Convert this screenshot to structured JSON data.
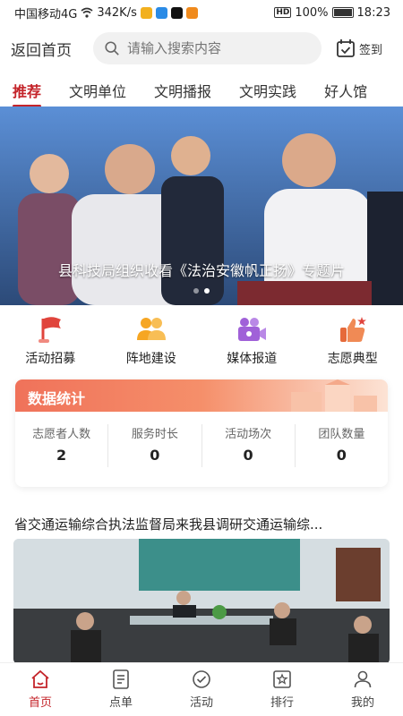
{
  "status_bar": {
    "carrier": "中国移动4G",
    "net_speed": "342K/s",
    "hd": "HD",
    "battery": "100%",
    "time": "18:23"
  },
  "header": {
    "back_label": "返回首页",
    "search_placeholder": "请输入搜索内容",
    "checkin_label": "签到"
  },
  "tabs": [
    {
      "label": "推荐",
      "active": true
    },
    {
      "label": "文明单位"
    },
    {
      "label": "文明播报"
    },
    {
      "label": "文明实践"
    },
    {
      "label": "好人馆"
    }
  ],
  "banner": {
    "caption": "县科技局组织收看《法治安徽帆正扬》专题片",
    "slide_count": 2,
    "active_slide": 2
  },
  "quick_menu": [
    {
      "label": "活动招募",
      "icon": "flag-icon"
    },
    {
      "label": "阵地建设",
      "icon": "people-icon"
    },
    {
      "label": "媒体报道",
      "icon": "video-camera-icon"
    },
    {
      "label": "志愿典型",
      "icon": "thumbs-up-icon"
    }
  ],
  "stats": {
    "title": "数据统计",
    "items": [
      {
        "label": "志愿者人数",
        "value": "2"
      },
      {
        "label": "服务时长",
        "value": "0"
      },
      {
        "label": "活动场次",
        "value": "0"
      },
      {
        "label": "团队数量",
        "value": "0"
      }
    ]
  },
  "news": {
    "title": "省交通运输综合执法监督局来我县调研交通运输综..."
  },
  "bottom_nav": [
    {
      "label": "首页",
      "icon": "home-icon",
      "active": true
    },
    {
      "label": "点单",
      "icon": "order-icon"
    },
    {
      "label": "活动",
      "icon": "activity-check-icon"
    },
    {
      "label": "排行",
      "icon": "ranking-star-icon"
    },
    {
      "label": "我的",
      "icon": "user-icon"
    }
  ],
  "colors": {
    "accent": "#c4242a",
    "stats_header": "#f0725a",
    "quick_red": "#e0443c",
    "quick_orange": "#f6a623",
    "quick_purple": "#a061d8"
  }
}
